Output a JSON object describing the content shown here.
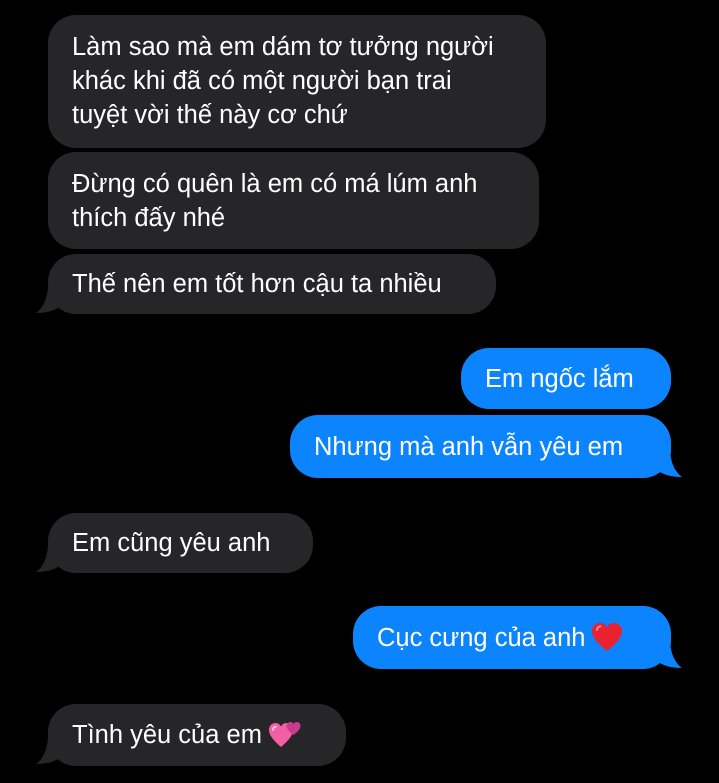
{
  "colors": {
    "background": "#000000",
    "received_bubble": "#262628",
    "sent_bubble": "#0b84fe",
    "text": "#ffffff"
  },
  "messages": [
    {
      "direction": "received",
      "lines": [
        "Làm sao mà em dám tơ tưởng người",
        "khác khi đã có một người bạn trai",
        "tuyệt vời thế này cơ chứ"
      ]
    },
    {
      "direction": "received",
      "lines": [
        "Đừng có quên là em có má lúm anh",
        "thích đấy nhé"
      ]
    },
    {
      "direction": "received",
      "lines": [
        "Thế nên em tốt hơn cậu ta nhiều"
      ]
    },
    {
      "direction": "sent",
      "lines": [
        "Em ngốc lắm"
      ]
    },
    {
      "direction": "sent",
      "lines": [
        "Nhưng mà anh vẫn yêu em"
      ]
    },
    {
      "direction": "received",
      "lines": [
        "Em cũng yêu anh"
      ]
    },
    {
      "direction": "sent",
      "lines": [
        "Cục cưng của anh"
      ],
      "emoji": "red-heart-icon"
    },
    {
      "direction": "received",
      "lines": [
        "Tình yêu của em"
      ],
      "emoji": "two-hearts-icon"
    }
  ]
}
